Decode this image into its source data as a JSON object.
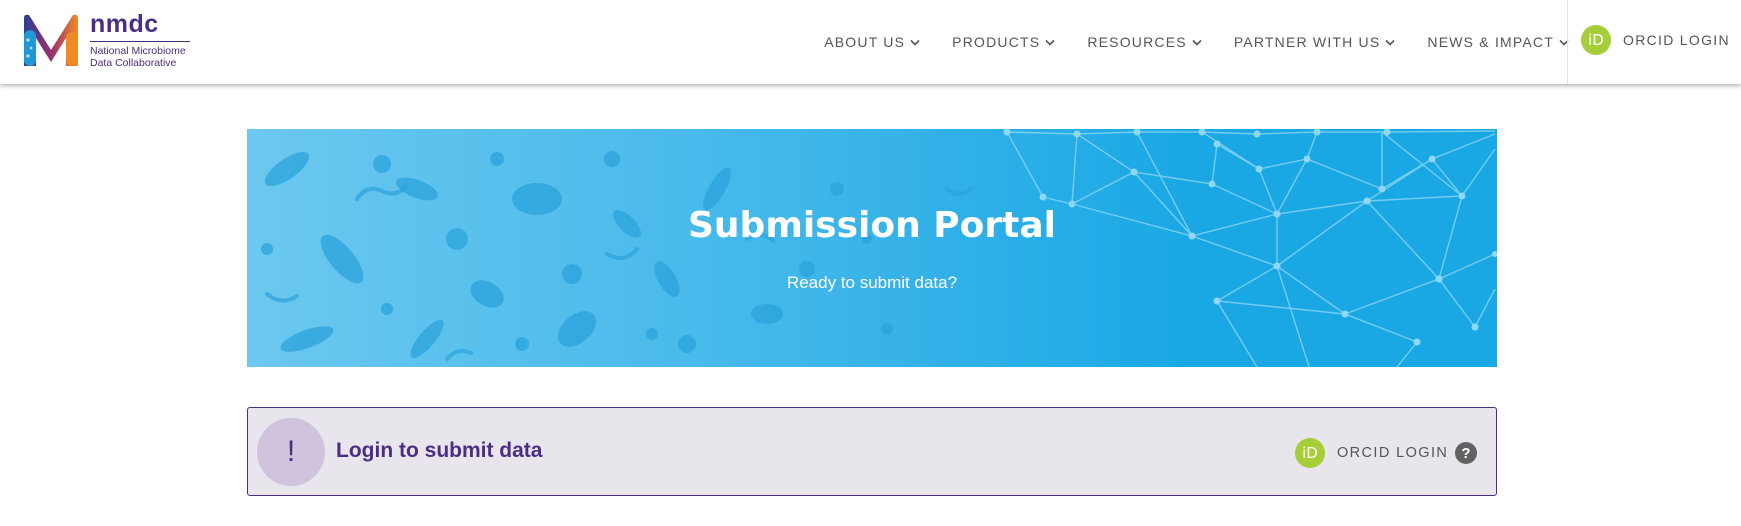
{
  "brand": {
    "name": "nmdc",
    "subtitle_line1": "National Microbiome",
    "subtitle_line2": "Data Collaborative",
    "colors": {
      "purple": "#4b2e83",
      "orange": "#ef7d22",
      "blue": "#1aa8e4",
      "orcid": "#a6ce39"
    }
  },
  "nav": {
    "items": [
      {
        "label": "ABOUT US",
        "icon": "chevron-down-icon"
      },
      {
        "label": "PRODUCTS",
        "icon": "chevron-down-icon"
      },
      {
        "label": "RESOURCES",
        "icon": "chevron-down-icon"
      },
      {
        "label": "PARTNER WITH US",
        "icon": "chevron-down-icon"
      },
      {
        "label": "NEWS & IMPACT",
        "icon": "chevron-down-icon"
      }
    ],
    "login": {
      "icon_text": "iD",
      "label": "ORCID LOGIN"
    }
  },
  "banner": {
    "title": "Submission Portal",
    "subtitle": "Ready to submit data?"
  },
  "alert": {
    "icon_text": "!",
    "message": "Login to submit data",
    "login": {
      "icon_text": "iD",
      "label": "ORCID LOGIN"
    },
    "help_icon_text": "?"
  }
}
